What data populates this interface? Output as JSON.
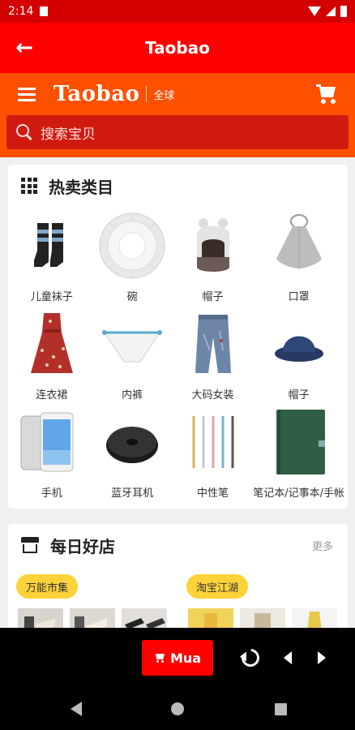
{
  "status_bar": {
    "time": "2:14"
  },
  "app_bar": {
    "title": "Taobao",
    "back_icon": "arrow-left-icon"
  },
  "taobao_header": {
    "brand": "Taobao",
    "brand_sub": "全球",
    "menu_icon": "hamburger-menu-icon",
    "cart_icon": "shopping-cart-icon",
    "search_placeholder": "搜索宝贝"
  },
  "hot_categories": {
    "title": "热卖类目",
    "icon": "grid-apps-icon",
    "items": [
      {
        "label": "儿童袜子",
        "icon": "socks-image"
      },
      {
        "label": "碗",
        "icon": "bowl-image"
      },
      {
        "label": "帽子",
        "icon": "knit-hat-image"
      },
      {
        "label": "口罩",
        "icon": "mask-image"
      },
      {
        "label": "连衣裙",
        "icon": "dress-image"
      },
      {
        "label": "内裤",
        "icon": "underwear-image"
      },
      {
        "label": "大码女装",
        "icon": "jeans-image"
      },
      {
        "label": "帽子",
        "icon": "bucket-hat-image"
      },
      {
        "label": "手机",
        "icon": "phone-image"
      },
      {
        "label": "蓝牙耳机",
        "icon": "earphone-image"
      },
      {
        "label": "中性笔",
        "icon": "pens-image"
      },
      {
        "label": "笔记本/记事本/手帐",
        "icon": "notebook-image"
      }
    ]
  },
  "daily_stores": {
    "title": "每日好店",
    "icon": "store-icon",
    "more": "更多",
    "stores": [
      {
        "name": "万能市集"
      },
      {
        "name": "淘宝江湖"
      }
    ]
  },
  "bottom_bar": {
    "buy_label": "Mua",
    "reload_icon": "reload-icon",
    "prev_icon": "arrow-left-triangle-icon",
    "next_icon": "arrow-right-triangle-icon"
  },
  "colors": {
    "app_bar": "#ff0000",
    "taobao_orange": "#ff5000",
    "search_bg": "#d11a0f",
    "pill_yellow": "#ffd23a"
  }
}
